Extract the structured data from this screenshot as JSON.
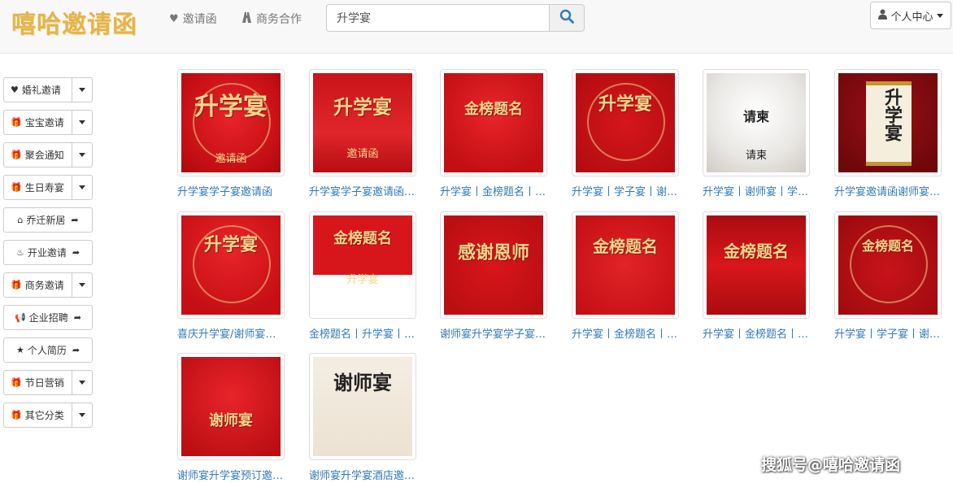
{
  "brand": {
    "name": "嘻哈邀请函",
    "color": "#e3b44f"
  },
  "nav": {
    "items": [
      {
        "icon": "heart-icon",
        "label": "邀请函"
      },
      {
        "icon": "road-icon",
        "label": "商务合作"
      }
    ],
    "search": {
      "value": "升学宴",
      "button_icon": "search-icon"
    },
    "user": {
      "icon": "user-icon",
      "label": "个人中心",
      "dropdown_icon": "chevron-down-icon"
    }
  },
  "sidebar": {
    "items": [
      {
        "icon": "heart-icon",
        "label": "婚礼邀请",
        "has_dropdown": true
      },
      {
        "icon": "gift-icon",
        "label": "宝宝邀请",
        "has_dropdown": true
      },
      {
        "icon": "gift-icon",
        "label": "聚会通知",
        "has_dropdown": true
      },
      {
        "icon": "gift-icon",
        "label": "生日寿宴",
        "has_dropdown": true
      },
      {
        "icon": "home-icon",
        "label": "乔迁新居",
        "has_dropdown": false
      },
      {
        "icon": "fire-icon",
        "label": "开业邀请",
        "has_dropdown": false
      },
      {
        "icon": "gift-icon",
        "label": "商务邀请",
        "has_dropdown": true
      },
      {
        "icon": "bullhorn-icon",
        "label": "企业招聘",
        "has_dropdown": false
      },
      {
        "icon": "star-icon",
        "label": "个人简历",
        "has_dropdown": false
      },
      {
        "icon": "gift-icon",
        "label": "节日营销",
        "has_dropdown": true
      },
      {
        "icon": "gift-icon",
        "label": "其它分类",
        "has_dropdown": true
      }
    ]
  },
  "cards": [
    {
      "title": "升学宴学子宴邀请函",
      "poster_text": "升学宴",
      "poster_sub": "邀请函",
      "theme": "a"
    },
    {
      "title": "升学宴学子宴邀请函升学宴谢师宴",
      "poster_text": "升学宴",
      "poster_sub": "邀请函",
      "theme": "b"
    },
    {
      "title": "升学宴丨金榜题名丨谢师宴",
      "poster_text": "金榜题名",
      "poster_sub": "",
      "theme": "c"
    },
    {
      "title": "升学宴丨学子宴丨谢师宴",
      "poster_text": "升学宴",
      "poster_sub": "",
      "theme": "d"
    },
    {
      "title": "升学宴丨谢师宴丨学子宴",
      "poster_text": "请柬",
      "poster_sub": "请柬",
      "theme": "e"
    },
    {
      "title": "升学宴邀请函谢师宴学子宴",
      "poster_text": "升学宴",
      "poster_sub": "",
      "theme": "f"
    },
    {
      "title": "喜庆升学宴/谢师宴邀请函",
      "poster_text": "升学宴",
      "poster_sub": "",
      "theme": "g"
    },
    {
      "title": "金榜题名丨升学宴丨谢师宴",
      "poster_text": "金榜题名",
      "poster_sub": "升学宴",
      "theme": "h"
    },
    {
      "title": "谢师宴升学宴学子宴邀请函",
      "poster_text": "感谢恩师",
      "poster_sub": "",
      "theme": "i"
    },
    {
      "title": "升学宴丨金榜题名丨谢师宴",
      "poster_text": "金榜题名",
      "poster_sub": "",
      "theme": "j"
    },
    {
      "title": "升学宴丨金榜题名丨谢师宴",
      "poster_text": "金榜题名",
      "poster_sub": "",
      "theme": "k"
    },
    {
      "title": "升学宴丨学子宴丨谢师宴",
      "poster_text": "金榜题名",
      "poster_sub": "",
      "theme": "l"
    },
    {
      "title": "谢师宴升学宴预订邀请函",
      "poster_text": "谢师宴",
      "poster_sub": "",
      "theme": "m"
    },
    {
      "title": "谢师宴升学宴酒店邀请函",
      "poster_text": "谢师宴",
      "poster_sub": "",
      "theme": "n"
    }
  ],
  "watermark": "搜狐号@嘻哈邀请函",
  "colors": {
    "link": "#337ab7",
    "poster_red": "#d4141a",
    "gold": "#f3d48a"
  }
}
